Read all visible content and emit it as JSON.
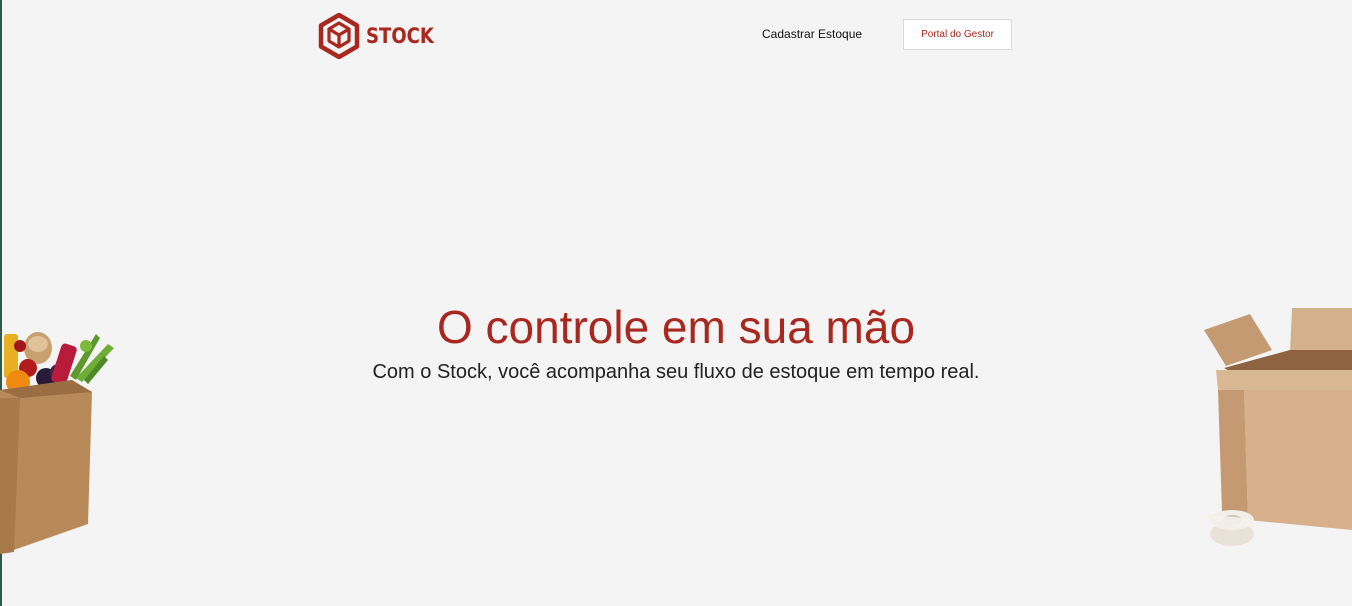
{
  "header": {
    "logo_text": "STOCK",
    "nav_link": "Cadastrar Estoque",
    "portal_button": "Portal do Gestor"
  },
  "hero": {
    "title": "O controle em sua mão",
    "subtitle": "Com o Stock, você acompanha seu fluxo de estoque em tempo real."
  },
  "colors": {
    "brand": "#a8271e",
    "background": "#f4f4f4",
    "text": "#222222"
  },
  "icons": {
    "logo": "hexagon-box-icon",
    "left_decoration": "grocery-bag-illustration",
    "right_decoration": "cardboard-box-illustration"
  }
}
